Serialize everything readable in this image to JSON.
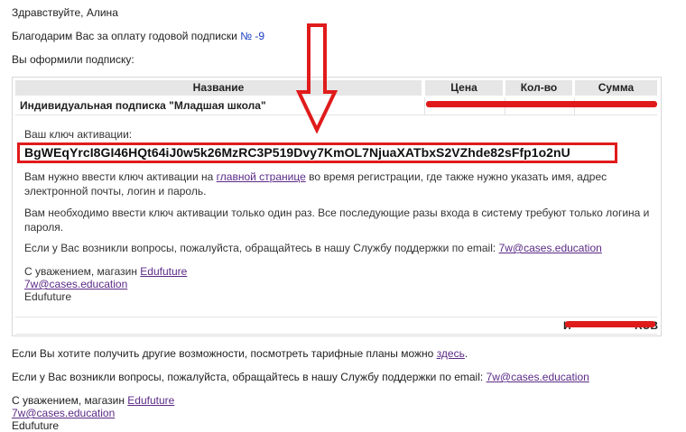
{
  "greeting": "Здравствуйте, Алина",
  "thanks": {
    "text": "Благодарим Вас за оплату годовой подписки",
    "order_link": "№ -9"
  },
  "subscribed": "Вы оформили подписку:",
  "table": {
    "headers": [
      "Название",
      "Цена",
      "Кол-во",
      "Сумма"
    ],
    "product": "Индивидуальная подписка \"Младшая школа\""
  },
  "activation": {
    "label": "Ваш ключ активации:",
    "key": "BgWEqYrcI8GI46HQt64iJ0w5k26MzRC3P519Dvy7KmOL7NjuaXATbxS2VZhde82sFfp1o2nU",
    "para1_before": "Вам нужно ввести ключ активации на",
    "para1_link": "главной странице",
    "para1_after": "во время регистрации, где также нужно указать имя, адрес электронной почты, логин и пароль.",
    "para2": "Вам необходимо ввести ключ активации только один раз. Все последующие разы входа в систему требуют только логина и пароля.",
    "support_text": "Если у Вас возникли вопросы, пожалуйста, обращайтесь в нашу Службу поддержки по email:",
    "support_email": "7w@cases.education",
    "regards": "С уважением, магазин",
    "shop_link": "Edufuture",
    "email": "7w@cases.education",
    "shop_name": "Edufuture"
  },
  "total_partial": "И",
  "total_tail": "RUB",
  "bottom": {
    "more_text": "Если Вы хотите получить другие возможности, посмотреть тарифные планы можно",
    "more_link": "здесь",
    "support_text": "Если у Вас возникли вопросы, пожалуйста, обращайтесь в нашу Службу поддержки по email:",
    "support_email": "7w@cases.education",
    "regards": "С уважением, магазин",
    "shop_link": "Edufuture",
    "email": "7w@cases.education",
    "shop_name": "Edufuture"
  },
  "colors": {
    "redaction": "#e01b1b",
    "link": "#1a3fbf",
    "visited": "#5b2a86",
    "header_bg": "#e6e6e6"
  }
}
